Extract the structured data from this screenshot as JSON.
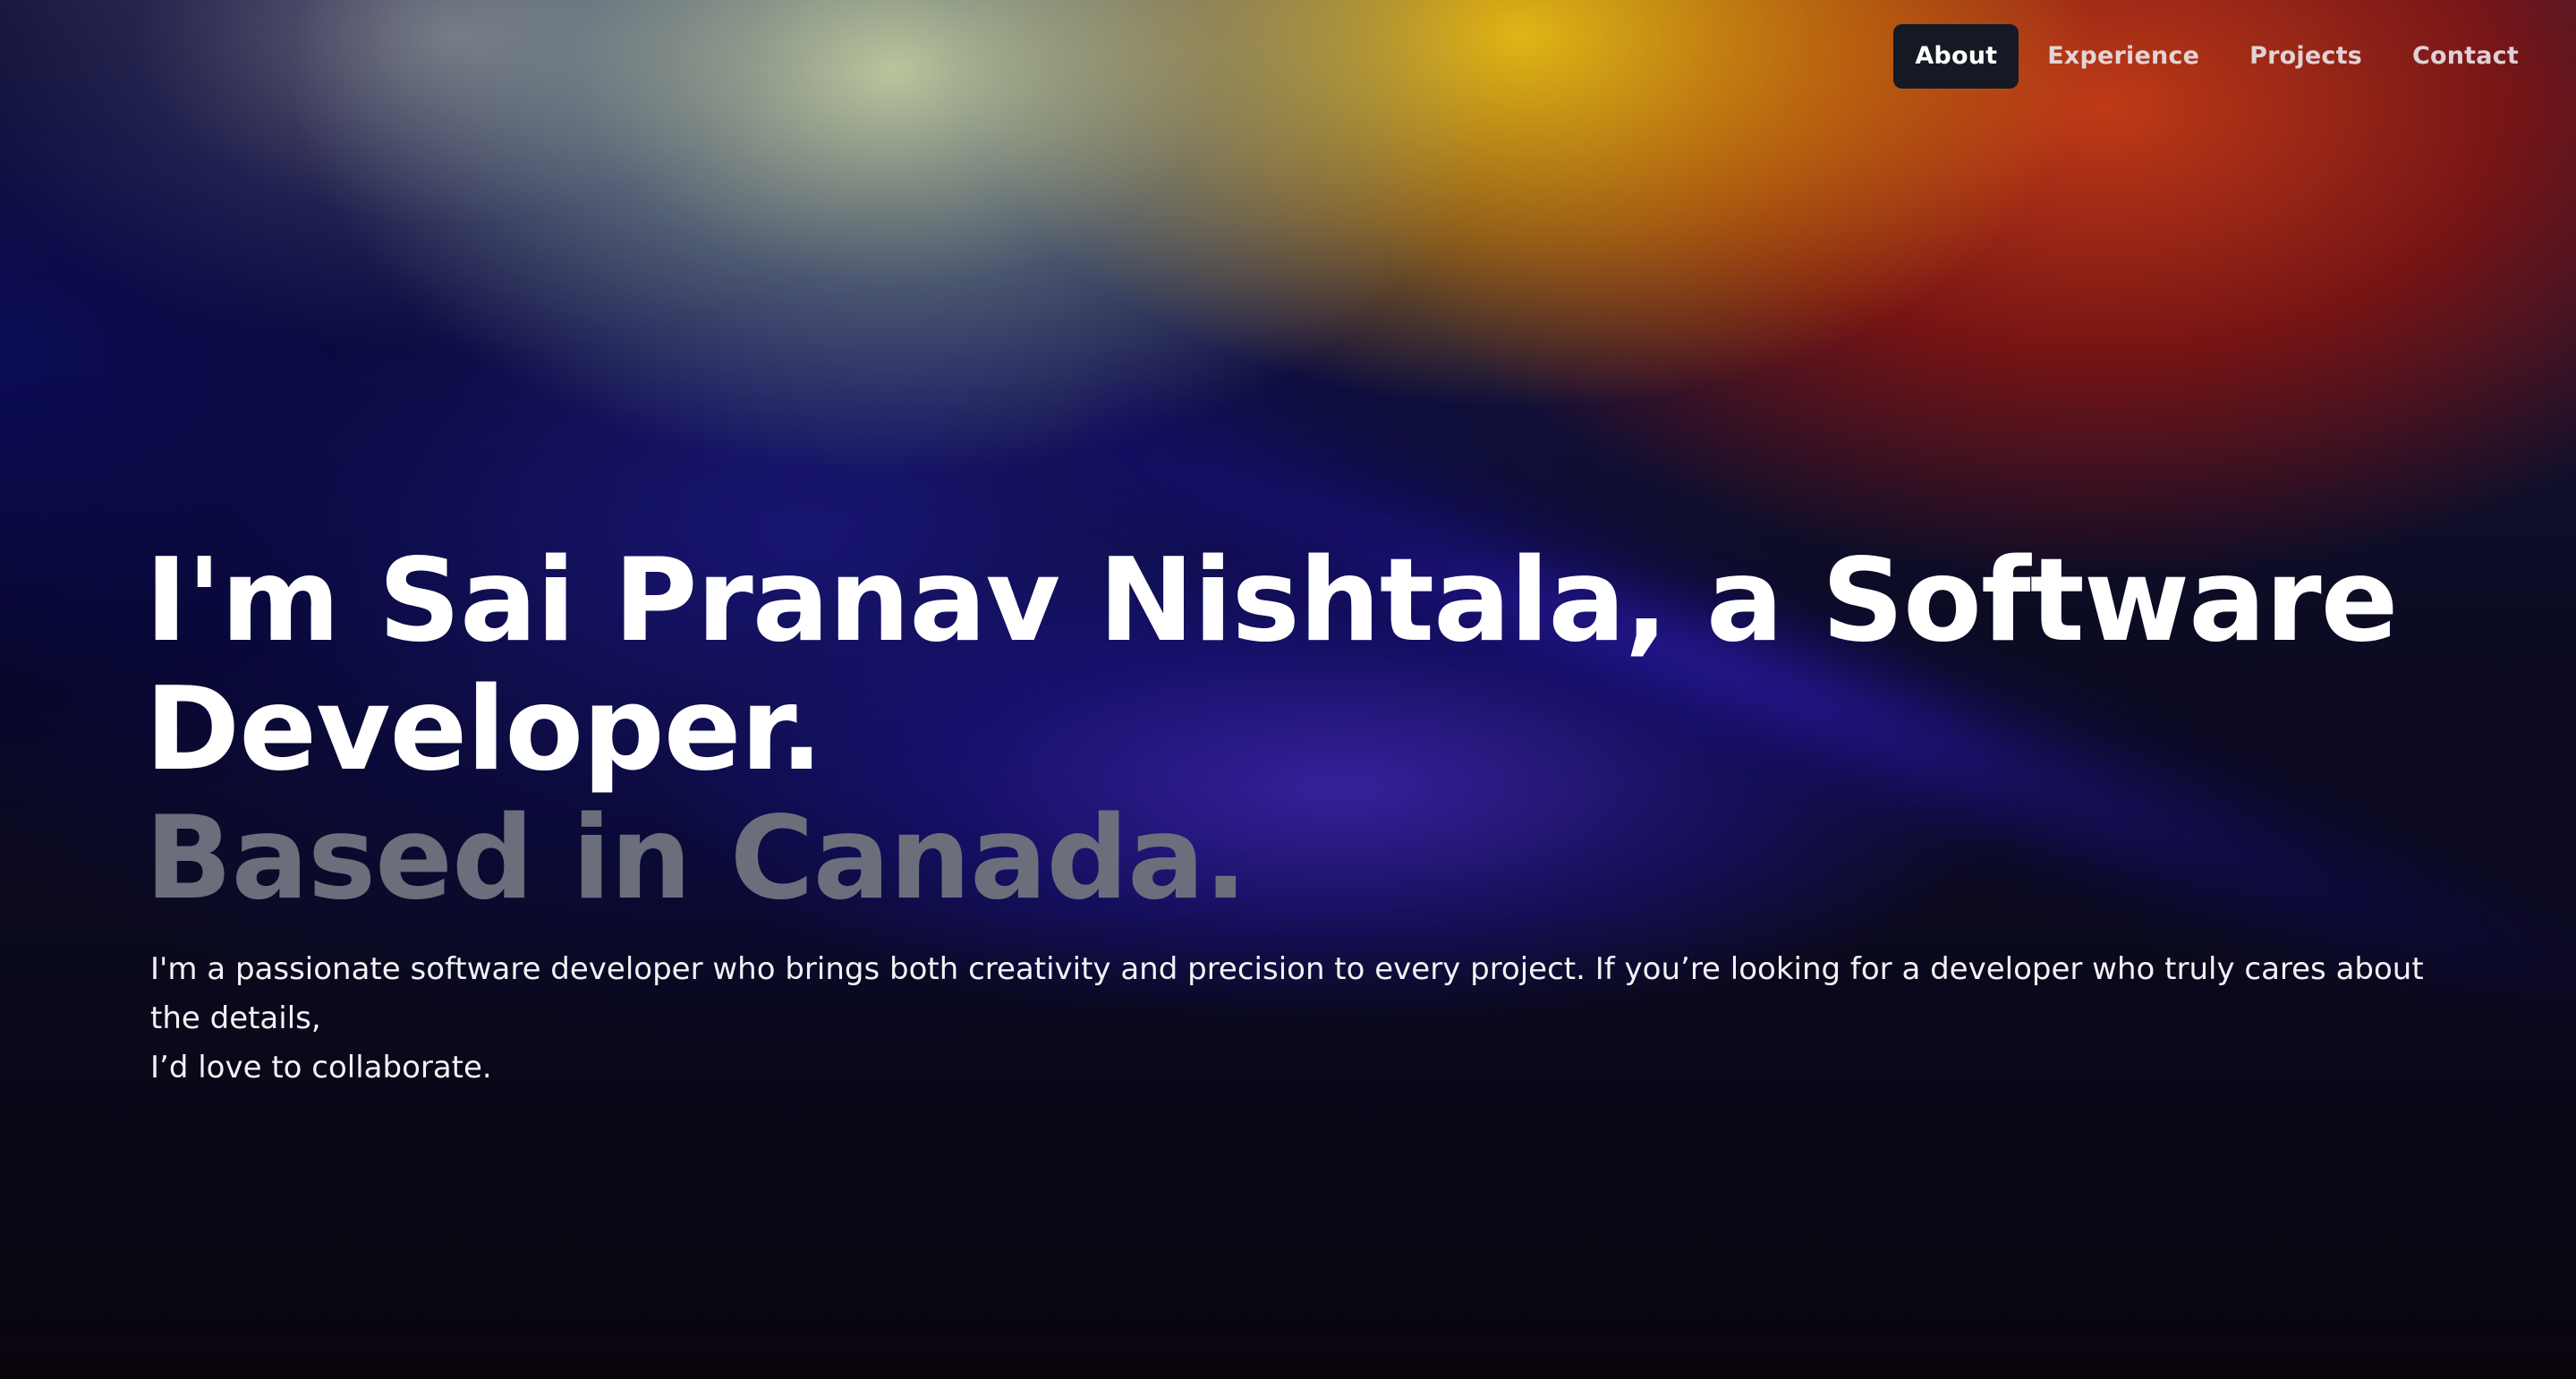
{
  "nav": {
    "items": [
      {
        "label": "About",
        "active": true
      },
      {
        "label": "Experience",
        "active": false
      },
      {
        "label": "Projects",
        "active": false
      },
      {
        "label": "Contact",
        "active": false
      }
    ]
  },
  "hero": {
    "headline_line1": "I'm Sai Pranav Nishtala, a Software",
    "headline_line2": "Developer.",
    "headline_line3": "Based in Canada.",
    "intro_line1": "I'm a passionate software developer who brings both creativity and precision to every project. If you’re looking for a developer who truly cares about the details,",
    "intro_line2": "I’d love to collaborate."
  },
  "colors": {
    "nav_active_bg": "#151923",
    "muted_text": "#6b6f7c",
    "text": "#ffffff"
  }
}
